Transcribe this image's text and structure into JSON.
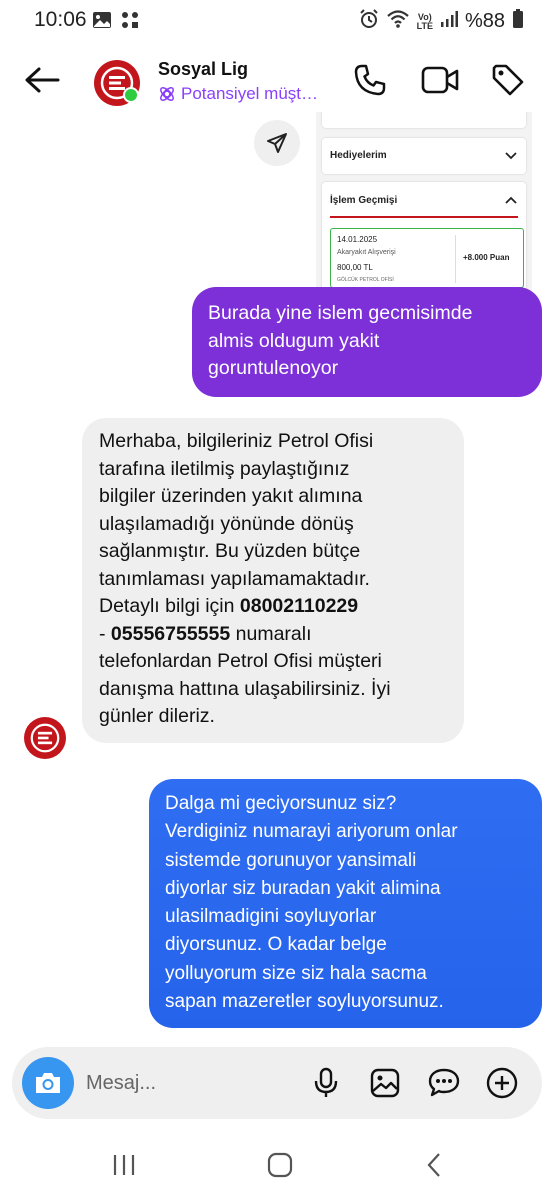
{
  "status_bar": {
    "time": "10:06",
    "battery_text": "%88",
    "network_badge_top": "Vo)",
    "network_badge_bottom": "LTE",
    "icons": [
      "image-icon",
      "dots-grid-icon",
      "alarm-icon",
      "wifi-icon",
      "signal-icon",
      "battery-icon"
    ]
  },
  "header": {
    "contact_name": "Sosyal Lig",
    "contact_subtitle": "Potansiyel müşt…",
    "icons": [
      "back-arrow-icon",
      "phone-icon",
      "video-icon",
      "tag-icon"
    ]
  },
  "preview": {
    "gifts_title": "Hediyelerim",
    "history_title": "İşlem Geçmişi",
    "entry_date": "14.01.2025",
    "entry_desc": "Akaryakıt Alışverişi",
    "entry_amount": "800,00 TL",
    "entry_station": "GÖLCÜK PETROL OFİSİ",
    "entry_points": "+8.000 Puan"
  },
  "messages": {
    "out1": [
      "Burada yine islem gecmisimde",
      "almis oldugum yakit",
      "goruntulenoyor"
    ],
    "in1": {
      "lines": [
        "Merhaba, bilgileriniz Petrol Ofisi",
        "tarafına iletilmiş paylaştığınız",
        "bilgiler üzerinden yakıt alımına",
        "ulaşılamadığı yönünde dönüş",
        "sağlanmıştır. Bu yüzden bütçe",
        "tanımlaması yapılamamaktadır."
      ],
      "detail_prefix": "Detaylı bilgi için ",
      "phone1": "08002110229",
      "dash": "- ",
      "phone2": "05556755555",
      "after_phone": " numaralı",
      "tail_lines": [
        "telefonlardan Petrol Ofisi müşteri",
        "danışma hattına ulaşabilirsiniz. İyi",
        "günler dileriz."
      ]
    },
    "out2": [
      "Dalga mi geciyorsunuz siz?",
      "Verdiginiz numarayi ariyorum onlar",
      "sistemde gorunuyor yansimali",
      "diyorlar siz buradan yakit alimina",
      "ulasilmadigini soyluyorlar",
      "diyorsunuz. O kadar belge",
      "yolluyorum size siz hala sacma",
      "sapan mazeretler soyluyorsunuz."
    ]
  },
  "composer": {
    "placeholder": "Mesaj...",
    "icons": [
      "camera-icon",
      "microphone-icon",
      "gallery-icon",
      "sticker-icon",
      "plus-icon"
    ]
  },
  "colors": {
    "outgoing_purple": "#7d2fd8",
    "outgoing_blue": "#2563eb",
    "incoming_gray": "#efefef",
    "brand_red": "#c3161c",
    "accent_purple": "#8a3ffc",
    "camera_blue": "#3797f0"
  }
}
